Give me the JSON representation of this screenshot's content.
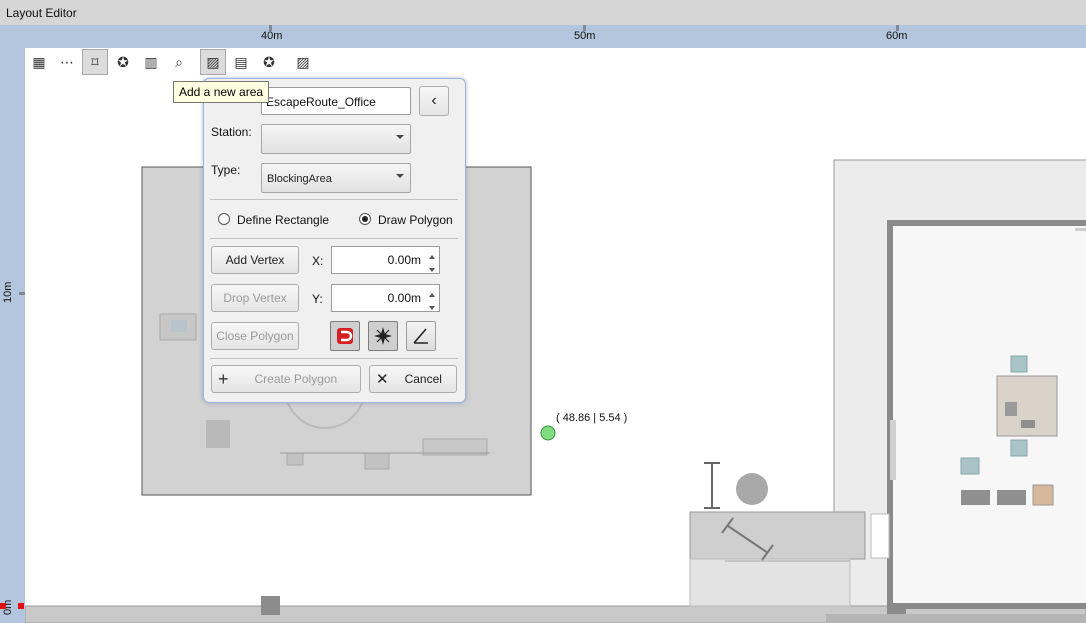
{
  "window": {
    "title": "Layout Editor"
  },
  "ruler": {
    "top_labels": [
      "40m",
      "50m",
      "60m"
    ],
    "left_labels": [
      "10m",
      "0m"
    ]
  },
  "toolbar": {
    "tools": [
      {
        "name": "grid-icon",
        "glyph": "▦"
      },
      {
        "name": "measure-icon",
        "glyph": "⋯"
      },
      {
        "name": "frame-icon",
        "glyph": "⌑"
      },
      {
        "name": "add-station-icon",
        "glyph": "✪"
      },
      {
        "name": "layers-icon",
        "glyph": "▥"
      },
      {
        "name": "search-icon",
        "glyph": "⌕"
      },
      {
        "name": "add-area-icon",
        "glyph": "▨"
      },
      {
        "name": "add-rail-icon",
        "glyph": "▤"
      },
      {
        "name": "add-zone-icon",
        "glyph": "✪"
      },
      {
        "name": "edit-area-icon",
        "glyph": "▨"
      }
    ],
    "tooltip": "Add a new area"
  },
  "panel": {
    "name_value": "EscapeRoute_Office",
    "collapse_glyph": "‹",
    "station_label": "Station:",
    "station_value": "",
    "type_label": "Type:",
    "type_value": "BlockingArea",
    "radio_rectangle": "Define Rectangle",
    "radio_polygon": "Draw Polygon",
    "selected_mode": "Draw Polygon",
    "add_vertex": "Add Vertex",
    "drop_vertex": "Drop Vertex",
    "close_polygon": "Close Polygon",
    "x_label": "X:",
    "y_label": "Y:",
    "x_value": "0.00m",
    "y_value": "0.00m",
    "create_polygon": "Create Polygon",
    "cancel": "Cancel",
    "plus_glyph": "+",
    "cancel_glyph": "✕"
  },
  "cursor": {
    "coords": "( 48.86 | 5.54 )"
  },
  "colors": {
    "ruler": "#b3c6de",
    "marker": "#7fdc7f",
    "magnet": "#d42020"
  }
}
